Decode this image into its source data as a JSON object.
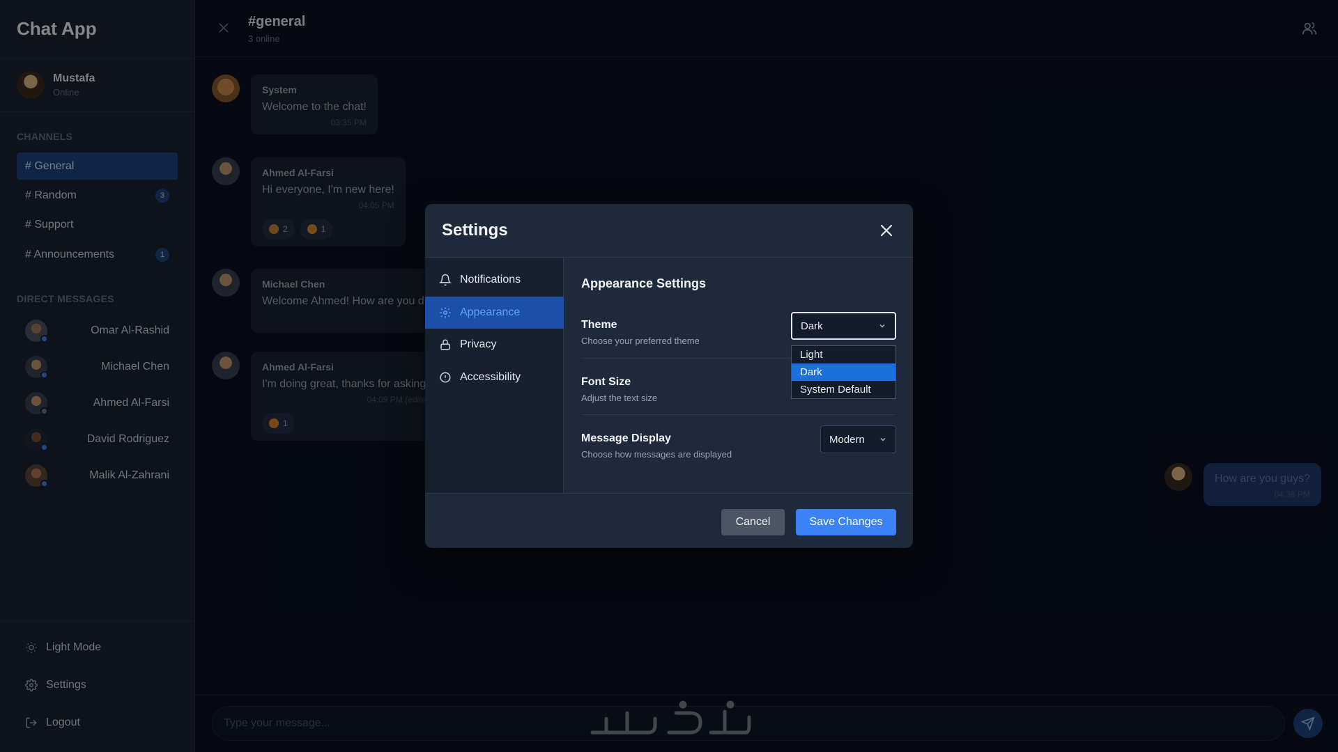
{
  "app": {
    "title": "Chat App"
  },
  "user": {
    "name": "Mustafa",
    "status": "Online"
  },
  "channels": {
    "heading": "CHANNELS",
    "items": [
      {
        "label": "# General",
        "badge": ""
      },
      {
        "label": "# Random",
        "badge": "3"
      },
      {
        "label": "# Support",
        "badge": ""
      },
      {
        "label": "# Announcements",
        "badge": "1"
      }
    ]
  },
  "direct_messages": {
    "heading": "DIRECT MESSAGES",
    "items": [
      {
        "name": "Omar Al-Rashid",
        "status_color": "#3b82f6"
      },
      {
        "name": "Michael Chen",
        "status_color": "#3b82f6"
      },
      {
        "name": "Ahmed Al-Farsi",
        "status_color": "#6b7280"
      },
      {
        "name": "David Rodriguez",
        "status_color": "#3b82f6"
      },
      {
        "name": "Malik Al-Zahrani",
        "status_color": "#3b82f6"
      }
    ]
  },
  "sidebar_bottom": {
    "light_mode": "Light Mode",
    "settings": "Settings",
    "logout": "Logout"
  },
  "header": {
    "channel": "#general",
    "online": "3 online"
  },
  "messages": [
    {
      "author": "System",
      "text": "Welcome to the chat!",
      "time": "03:35 PM"
    },
    {
      "author": "Ahmed Al-Farsi",
      "text": "Hi everyone, I'm new here!",
      "time": "04:05 PM",
      "reactions": [
        {
          "emoji": "clap",
          "count": "2"
        },
        {
          "emoji": "smile",
          "count": "1"
        }
      ]
    },
    {
      "author": "Michael Chen",
      "text": "Welcome Ahmed! How are you d",
      "time": ""
    },
    {
      "author": "Ahmed Al-Farsi",
      "text": "I'm doing great, thanks for asking",
      "time": "04:09 PM",
      "edited": "(edite",
      "reactions": [
        {
          "emoji": "heart",
          "count": "1"
        }
      ]
    }
  ],
  "own_message": {
    "text": "How are you guys?",
    "time": "04:36 PM"
  },
  "composer": {
    "placeholder": "Type your message..."
  },
  "settings_modal": {
    "title": "Settings",
    "nav": [
      {
        "label": "Notifications",
        "icon": "bell-icon"
      },
      {
        "label": "Appearance",
        "icon": "gear-icon",
        "active": true
      },
      {
        "label": "Privacy",
        "icon": "lock-icon"
      },
      {
        "label": "Accessibility",
        "icon": "info-icon"
      }
    ],
    "section_title": "Appearance Settings",
    "theme": {
      "label": "Theme",
      "desc": "Choose your preferred theme",
      "value": "Dark",
      "options": [
        "Light",
        "Dark",
        "System Default"
      ]
    },
    "font_size": {
      "label": "Font Size",
      "desc": "Adjust the text size"
    },
    "message_display": {
      "label": "Message Display",
      "desc": "Choose how messages are displayed",
      "value": "Modern"
    },
    "cancel": "Cancel",
    "save": "Save Changes"
  },
  "colors": {
    "accent": "#3b82f6",
    "active_nav": "#1e4fa8",
    "sidebar_bg": "#1a2332",
    "main_bg": "#0b1220"
  }
}
